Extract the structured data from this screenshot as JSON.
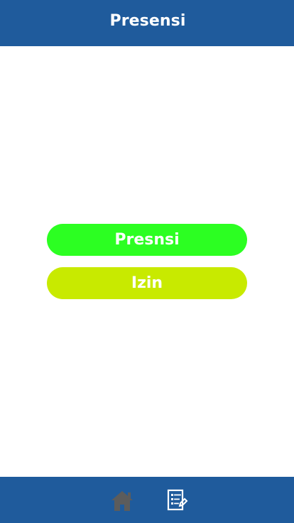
{
  "header": {
    "title": "Presensi"
  },
  "actions": {
    "presensi_label": "Presnsi",
    "izin_label": "Izin"
  },
  "bottom_nav": {
    "items": [
      {
        "icon": "home-icon"
      },
      {
        "icon": "document-edit-icon"
      }
    ]
  },
  "colors": {
    "header_background": "#1f5b9c",
    "bottom_nav_background": "#1f5b9c",
    "presensi_button": "#2cff22",
    "izin_button": "#c8ea00",
    "home_icon": "#5c5c5c",
    "document_icon": "#ffffff"
  }
}
